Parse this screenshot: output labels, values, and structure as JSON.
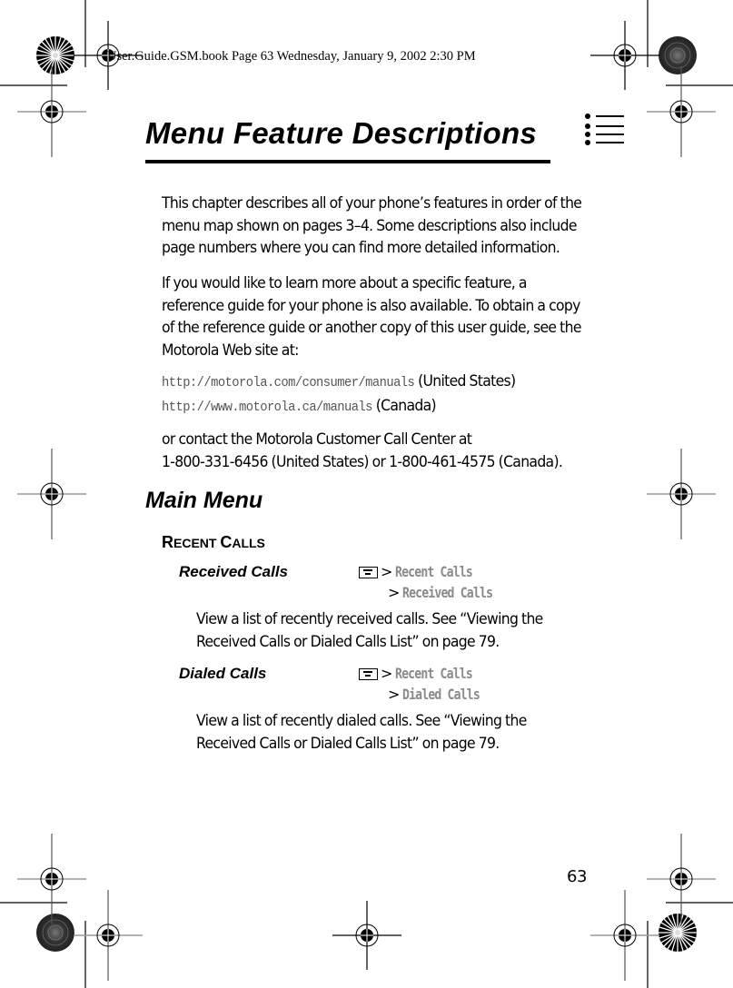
{
  "print_header": "User.Guide.GSM.book  Page 63  Wednesday, January 9, 2002  2:30 PM",
  "chapter": {
    "title": "Menu Feature Descriptions",
    "icon": "menu-list-icon"
  },
  "intro": {
    "paragraph1": [
      "This chapter describes all of your phone’s features in order of the",
      "menu map shown on pages 3–4. Some descriptions also include",
      "page numbers where you can find more detailed information."
    ],
    "paragraph2": [
      "If you would like to learn more about a specific feature, a",
      "reference guide for your phone is also available. To obtain a copy",
      "of the reference guide or another copy of this user guide, see the",
      "Motorola Web site at:"
    ],
    "urls": [
      {
        "url": "http://motorola.com/consumer/manuals",
        "region": "(United States)"
      },
      {
        "url": "http://www.motorola.ca/manuals",
        "region": "(Canada)"
      }
    ],
    "paragraph3": [
      "or contact the Motorola Customer Call Center at",
      "1-800-331-6456 (United States) or 1-800-461-4575 (Canada)."
    ]
  },
  "main_menu": {
    "heading": "Main Menu",
    "section": {
      "title_parts": [
        {
          "cap": "R",
          "rest": "ECENT "
        },
        {
          "cap": "C",
          "rest": "ALLS"
        }
      ],
      "title_text": "Recent Calls",
      "features": [
        {
          "name": "Received Calls",
          "key_icon": "menu-key-icon",
          "separator": ">",
          "path": [
            "Recent Calls",
            "Received Calls"
          ],
          "description": [
            "View a list of recently received calls. See “Viewing the",
            "Received Calls or Dialed Calls List” on page 79."
          ]
        },
        {
          "name": "Dialed Calls",
          "key_icon": "menu-key-icon",
          "separator": ">",
          "path": [
            "Recent Calls",
            "Dialed Calls"
          ],
          "description": [
            "View a list of recently dialed calls. See “Viewing the",
            "Received Calls or Dialed Calls List” on page 79."
          ]
        }
      ]
    }
  },
  "page_number": "63"
}
